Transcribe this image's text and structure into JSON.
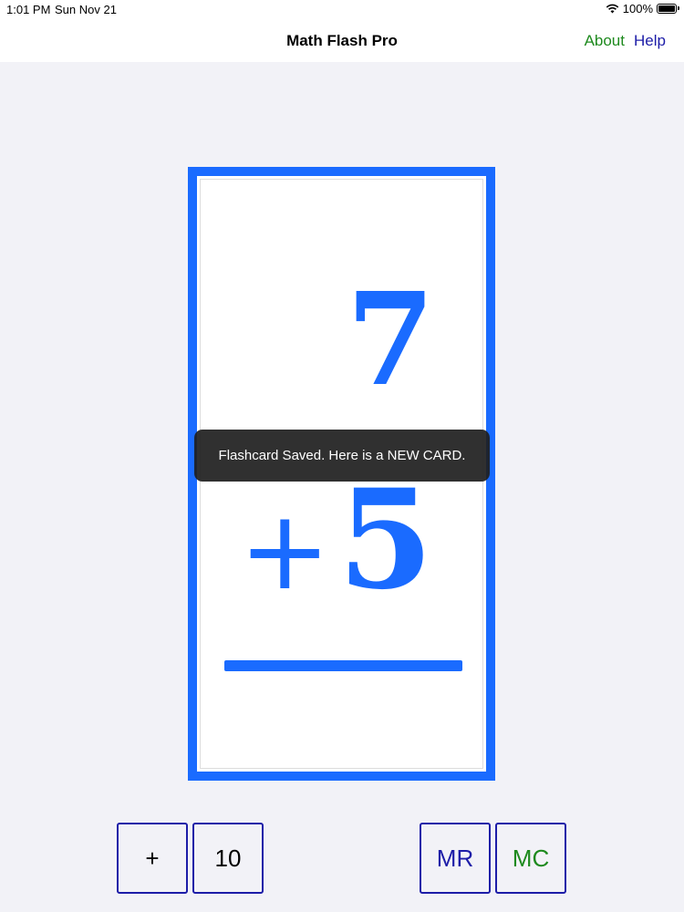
{
  "status_bar": {
    "time": "1:01 PM",
    "date": "Sun Nov 21",
    "battery": "100%",
    "battery_level": 1.0
  },
  "nav": {
    "title": "Math Flash Pro",
    "about_label": "About",
    "help_label": "Help"
  },
  "flashcard": {
    "top_number": "7",
    "operator": "+",
    "bottom_number": "5"
  },
  "toast": {
    "message": "Flashcard Saved. Here is a NEW CARD."
  },
  "controls": {
    "operator_label": "+",
    "max_label": "10",
    "mr_label": "MR",
    "mc_label": "MC"
  },
  "colors": {
    "card_blue": "#1a6bff",
    "about_green": "#1e8a1e",
    "help_navy": "#1d1da8",
    "button_border": "#1d1da8"
  },
  "icons": [
    "wifi-icon",
    "battery-icon"
  ]
}
